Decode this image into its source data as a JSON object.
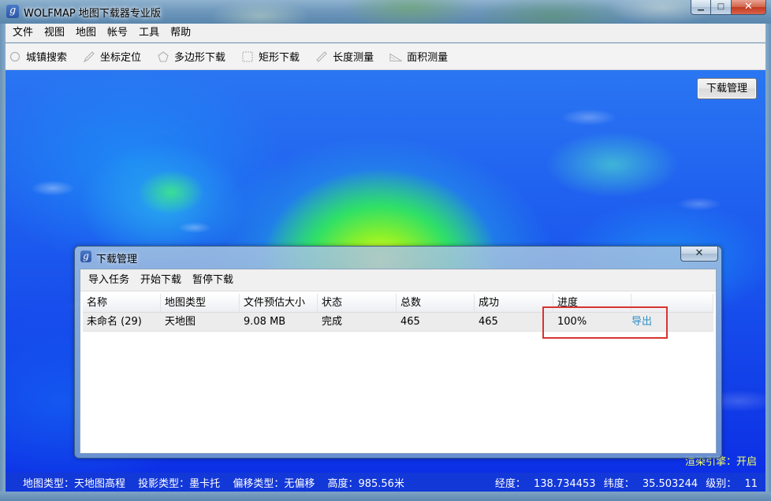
{
  "window": {
    "title": "WOLFMAP 地图下载器专业版",
    "app_icon_glyph": "g",
    "controls": {
      "minimize": "▁",
      "maximize": "□",
      "close": "✕"
    }
  },
  "menu": [
    "文件",
    "视图",
    "地图",
    "帐号",
    "工具",
    "帮助"
  ],
  "toolbar": [
    {
      "label": "城镇搜索",
      "icon": "circle-icon"
    },
    {
      "label": "坐标定位",
      "icon": "pencil-icon"
    },
    {
      "label": "多边形下载",
      "icon": "pentagon-icon"
    },
    {
      "label": "矩形下载",
      "icon": "rectangle-icon"
    },
    {
      "label": "长度测量",
      "icon": "ruler-icon"
    },
    {
      "label": "面积测量",
      "icon": "area-icon"
    }
  ],
  "download_manager_button": "下载管理",
  "render_engine": "渲染引擎：开启",
  "status": {
    "map_type": "地图类型：天地图高程",
    "projection": "投影类型：墨卡托",
    "offset": "偏移类型：无偏移",
    "altitude": "高度：985.56米",
    "longitude_label": "经度：",
    "longitude_value": "138.734453",
    "latitude_label": "纬度：",
    "latitude_value": "35.503244",
    "level_label": "级别：",
    "level_value": "11"
  },
  "dialog": {
    "title": "下载管理",
    "close": "✕",
    "menu": [
      "导入任务",
      "开始下载",
      "暂停下载"
    ],
    "columns": [
      "名称",
      "地图类型",
      "文件预估大小",
      "状态",
      "总数",
      "成功",
      "进度",
      ""
    ],
    "rows": [
      [
        "未命名 (29)",
        "天地图",
        "9.08 MB",
        "完成",
        "465",
        "465",
        "100%",
        "导出"
      ]
    ]
  },
  "colors": {
    "highlight_box": "#d8342e",
    "export_link": "#2a8fc8",
    "status_bar": "#1338d8",
    "engine_text": "#f3ff6a"
  }
}
